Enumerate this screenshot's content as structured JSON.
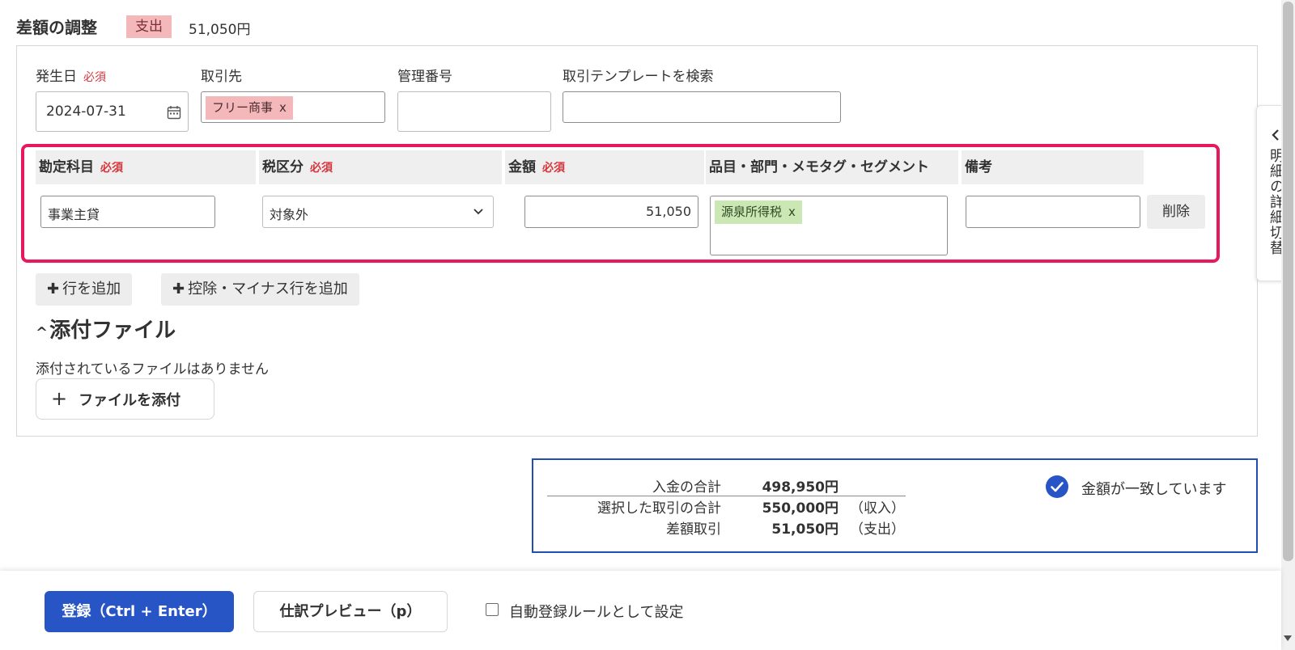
{
  "header": {
    "title": "差額の調整",
    "badge": "支出",
    "amount": "51,050円"
  },
  "form": {
    "date_label": "発生日",
    "required": "必須",
    "date_value": "2024-07-31",
    "partner_label": "取引先",
    "partner_tag": "フリー商事",
    "mgmt_label": "管理番号",
    "template_label": "取引テンプレートを検索"
  },
  "table": {
    "headers": {
      "account": "勘定科目",
      "tax": "税区分",
      "amount": "金額",
      "item": "品目・部門・メモタグ・セグメント",
      "memo": "備考"
    },
    "row": {
      "account": "事業主貸",
      "tax": "対象外",
      "amount": "51,050",
      "item_tag": "源泉所得税",
      "memo": "",
      "delete": "削除"
    }
  },
  "remove_x": "x",
  "actions": {
    "add_row": "行を追加",
    "add_deduction": "控除・マイナス行を追加"
  },
  "attachments": {
    "title": "添付ファイル",
    "empty": "添付されているファイルはありません",
    "attach_button": "ファイルを添付"
  },
  "summary": {
    "rows": [
      {
        "label": "入金の合計",
        "value": "498,950円",
        "note": ""
      },
      {
        "label": "選択した取引の合計",
        "value": "550,000円",
        "note": "（収入）"
      },
      {
        "label": "差額取引",
        "value": "51,050円",
        "note": "（支出）"
      }
    ],
    "match_text": "金額が一致しています"
  },
  "side_tab": {
    "label": "明細の詳細切替"
  },
  "footer": {
    "register": "登録（Ctrl + Enter）",
    "preview": "仕訳プレビュー（p）",
    "auto_rule": "自動登録ルールとして設定"
  },
  "colors": {
    "accent": "#2855c6",
    "highlight": "#e8185f",
    "expense_tag": "#f4b8bb",
    "item_tag": "#cbe8b4",
    "summary_border": "#1f4fb3"
  }
}
